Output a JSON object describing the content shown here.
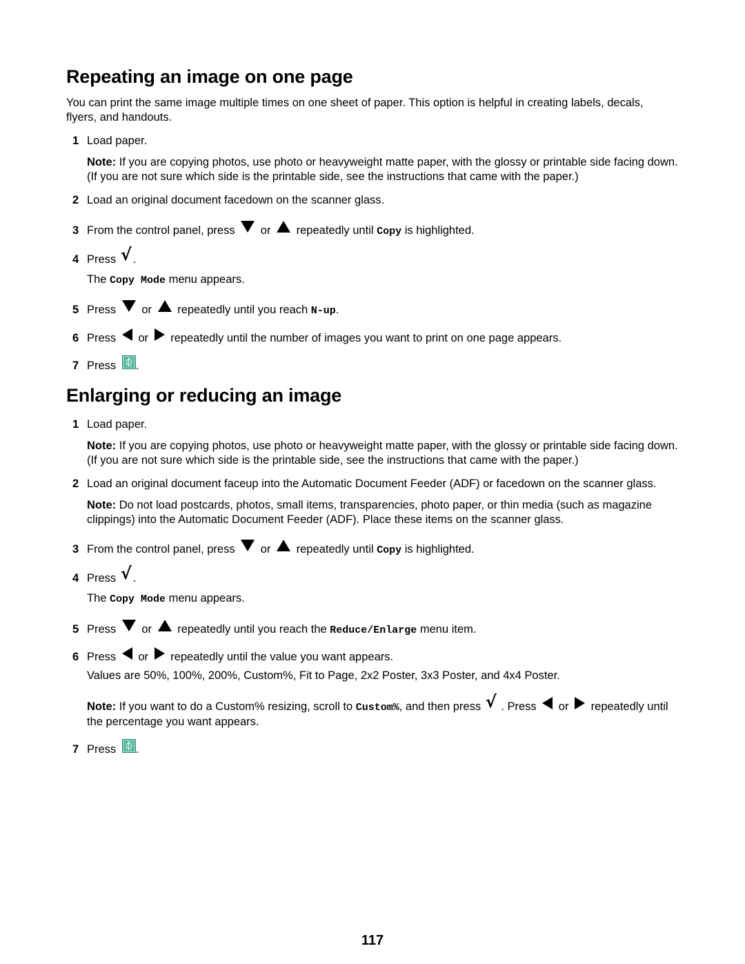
{
  "section1": {
    "title": "Repeating an image on one page",
    "intro": "You can print the same image multiple times on one sheet of paper. This option is helpful in creating labels, decals, flyers, and handouts.",
    "steps": [
      {
        "num": "1",
        "text": "Load paper."
      },
      {
        "note_label": "Note:",
        "note_text": " If you are copying photos, use photo or heavyweight matte paper, with the glossy or printable side facing down. (If you are not sure which side is the printable side, see the instructions that came with the paper.)"
      },
      {
        "num": "2",
        "text": "Load an original document facedown on the scanner glass."
      },
      {
        "num": "3",
        "pre": "From the control panel, press ",
        "or": " or ",
        "post": " repeatedly until ",
        "code": "Copy",
        "end": " is highlighted."
      },
      {
        "num": "4",
        "pre": "Press ",
        "end": "."
      },
      {
        "sub_pre": "The ",
        "sub_code": "Copy Mode",
        "sub_post": " menu appears."
      },
      {
        "num": "5",
        "pre": "Press ",
        "or": " or ",
        "post": " repeatedly until you reach ",
        "code": "N-up",
        "end": "."
      },
      {
        "num": "6",
        "pre": "Press ",
        "or": " or ",
        "post": " repeatedly until the number of images you want to print on one page appears."
      },
      {
        "num": "7",
        "pre": "Press ",
        "end": "."
      }
    ]
  },
  "section2": {
    "title": "Enlarging or reducing an image",
    "steps": [
      {
        "num": "1",
        "text": "Load paper."
      },
      {
        "note_label": "Note:",
        "note_text": " If you are copying photos, use photo or heavyweight matte paper, with the glossy or printable side facing down. (If you are not sure which side is the printable side, see the instructions that came with the paper.)"
      },
      {
        "num": "2",
        "text": "Load an original document faceup into the Automatic Document Feeder (ADF) or facedown on the scanner glass."
      },
      {
        "note_label": "Note:",
        "note_text": " Do not load postcards, photos, small items, transparencies, photo paper, or thin media (such as magazine clippings) into the Automatic Document Feeder (ADF). Place these items on the scanner glass."
      },
      {
        "num": "3",
        "pre": "From the control panel, press ",
        "or": " or ",
        "post": " repeatedly until ",
        "code": "Copy",
        "end": " is highlighted."
      },
      {
        "num": "4",
        "pre": "Press ",
        "end": "."
      },
      {
        "sub_pre": "The ",
        "sub_code": "Copy Mode",
        "sub_post": " menu appears."
      },
      {
        "num": "5",
        "pre": "Press ",
        "or": " or ",
        "post": " repeatedly until you reach the ",
        "code": "Reduce/Enlarge",
        "end": " menu item."
      },
      {
        "num": "6",
        "pre": "Press ",
        "or": " or ",
        "post": " repeatedly until the value you want appears."
      },
      {
        "values_text": "Values are 50%, 100%, 200%, Custom%, Fit to Page, 2x2 Poster, 3x3 Poster, and 4x4 Poster."
      },
      {
        "note_label": "Note:",
        "note_pre": " If you want to do a Custom% resizing, scroll to ",
        "note_code": "Custom%",
        "note_mid": ", and then press ",
        "note_mid2": " . Press ",
        "note_or": " or ",
        "note_post": " repeatedly until the percentage you want appears."
      },
      {
        "num": "7",
        "pre": "Press ",
        "end": "."
      }
    ]
  },
  "icons": {
    "down": "down-arrow-button",
    "up": "up-arrow-button",
    "left": "left-arrow-button",
    "right": "right-arrow-button",
    "select": "checkmark-select-button",
    "start": "start-button",
    "check_glyph": "√",
    "start_color": "#5fbba3"
  },
  "page_number": "117"
}
